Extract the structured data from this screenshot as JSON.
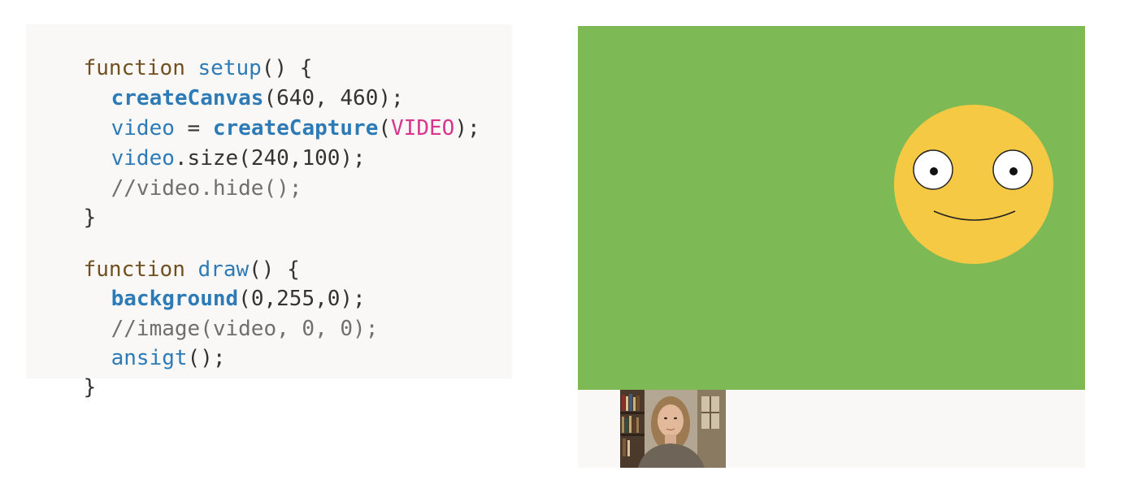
{
  "code": {
    "setup": {
      "kw": "function",
      "name": "setup",
      "sig_open": "() {",
      "l1_fn": "createCanvas",
      "l1_args": "(640, 460);",
      "l2_var": "video",
      "l2_eq": " = ",
      "l2_fn": "createCapture",
      "l2_open": "(",
      "l2_const": "VIDEO",
      "l2_close": ");",
      "l3_obj": "video",
      "l3_rest": ".size(240,100);",
      "l4_comment": "//video.hide();",
      "close": "}"
    },
    "draw": {
      "kw": "function",
      "name": "draw",
      "sig_open": "() {",
      "l1_fn": "background",
      "l1_args": "(0,255,0);",
      "l2_comment": "//image(video, 0, 0);",
      "l3_fn": "ansigt",
      "l3_rest": "();",
      "close": "}"
    }
  },
  "sketch": {
    "canvas_color": "#7dba55",
    "face_color": "#f6c944",
    "eye_color": "#ffffff",
    "pupil_color": "#111111"
  }
}
